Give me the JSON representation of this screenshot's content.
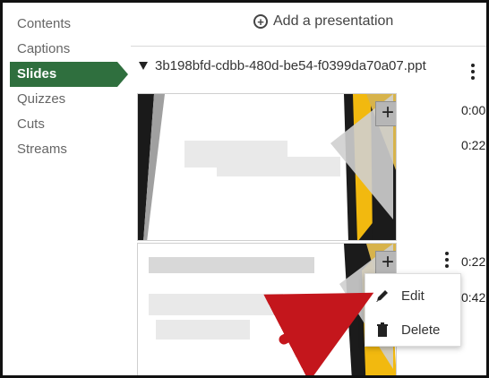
{
  "sidebar": {
    "items": [
      {
        "label": "Contents"
      },
      {
        "label": "Captions"
      },
      {
        "label": "Slides",
        "active": true
      },
      {
        "label": "Quizzes"
      },
      {
        "label": "Cuts"
      },
      {
        "label": "Streams"
      }
    ]
  },
  "header": {
    "add_presentation_label": "Add a presentation"
  },
  "file": {
    "name": "3b198bfd-cdbb-480d-be54-f0399da70a07.ppt"
  },
  "slides": [
    {
      "times": [
        "0:00",
        "0:22"
      ]
    },
    {
      "times": [
        "0:22",
        "0:42"
      ]
    }
  ],
  "context_menu": {
    "items": [
      {
        "label": "Edit"
      },
      {
        "label": "Delete"
      }
    ]
  },
  "colors": {
    "active_nav": "#2f6f3e",
    "arrow": "#c4161c",
    "slide_gold": "#f2b90f"
  }
}
